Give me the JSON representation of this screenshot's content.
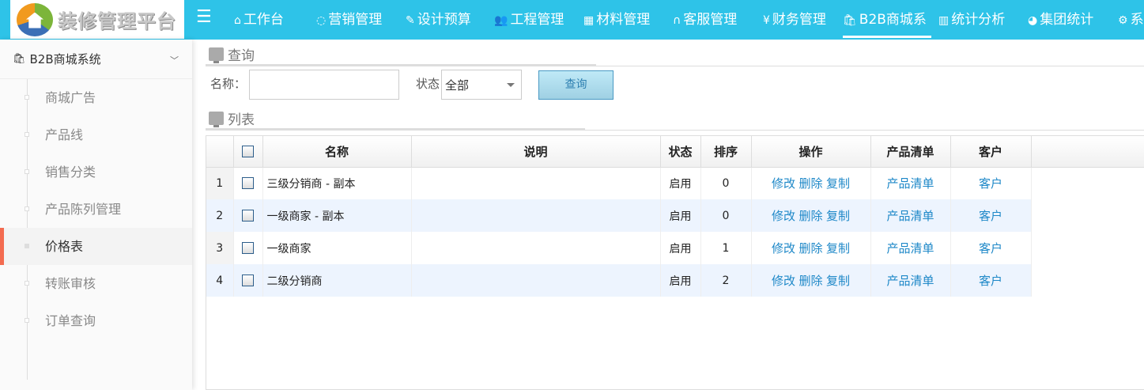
{
  "header": {
    "logo_text": "装修管理平台",
    "menu_icon": "hamburger-icon",
    "nav": [
      {
        "icon": "home-icon",
        "glyph": "⌂",
        "label": "工作台"
      },
      {
        "icon": "chat-icon",
        "glyph": "◌",
        "label": "营销管理"
      },
      {
        "icon": "edit-icon",
        "glyph": "✎",
        "label": "设计预算"
      },
      {
        "icon": "users-icon",
        "glyph": "👥",
        "label": "工程管理"
      },
      {
        "icon": "grid-icon",
        "glyph": "▦",
        "label": "材料管理"
      },
      {
        "icon": "headset-icon",
        "glyph": "∩",
        "label": "客服管理"
      },
      {
        "icon": "yen-icon",
        "glyph": "¥",
        "label": "财务管理"
      },
      {
        "icon": "shopping-bag-icon",
        "glyph": "🛍",
        "label": "B2B商城系",
        "active": true
      },
      {
        "icon": "bar-chart-icon",
        "glyph": "▥",
        "label": "统计分析"
      },
      {
        "icon": "pie-chart-icon",
        "glyph": "◕",
        "label": "集团统计"
      },
      {
        "icon": "gear-icon",
        "glyph": "⚙",
        "label": "系"
      }
    ]
  },
  "sidebar": {
    "title": "B2B商城系统",
    "items": [
      {
        "label": "商城广告"
      },
      {
        "label": "产品线"
      },
      {
        "label": "销售分类"
      },
      {
        "label": "产品陈列管理"
      },
      {
        "label": "价格表",
        "active": true
      },
      {
        "label": "转账审核"
      },
      {
        "label": "订单查询"
      }
    ]
  },
  "query": {
    "title": "查询",
    "name_label": "名称：",
    "name_value": "",
    "status_label": "状态",
    "status_value": "全部",
    "search_button": "查询"
  },
  "list": {
    "title": "列表",
    "columns": [
      "名称",
      "说明",
      "状态",
      "排序",
      "操作",
      "产品清单",
      "客户"
    ],
    "actions": [
      "修改",
      "删除",
      "复制"
    ],
    "rows": [
      {
        "no": "1",
        "name": "三级分销商 - 副本",
        "desc": "",
        "status": "启用",
        "order": "0",
        "products": "产品清单",
        "customers": "客户"
      },
      {
        "no": "2",
        "name": "一级商家 - 副本",
        "desc": "",
        "status": "启用",
        "order": "0",
        "products": "产品清单",
        "customers": "客户"
      },
      {
        "no": "3",
        "name": "一级商家",
        "desc": "",
        "status": "启用",
        "order": "1",
        "products": "产品清单",
        "customers": "客户"
      },
      {
        "no": "4",
        "name": "二级分销商",
        "desc": "",
        "status": "启用",
        "order": "2",
        "products": "产品清单",
        "customers": "客户"
      }
    ]
  },
  "colors": {
    "header": "#2ec3e8",
    "active_marker": "#f36b50",
    "link": "#1e88c8",
    "alt_row": "#edf4fe"
  }
}
